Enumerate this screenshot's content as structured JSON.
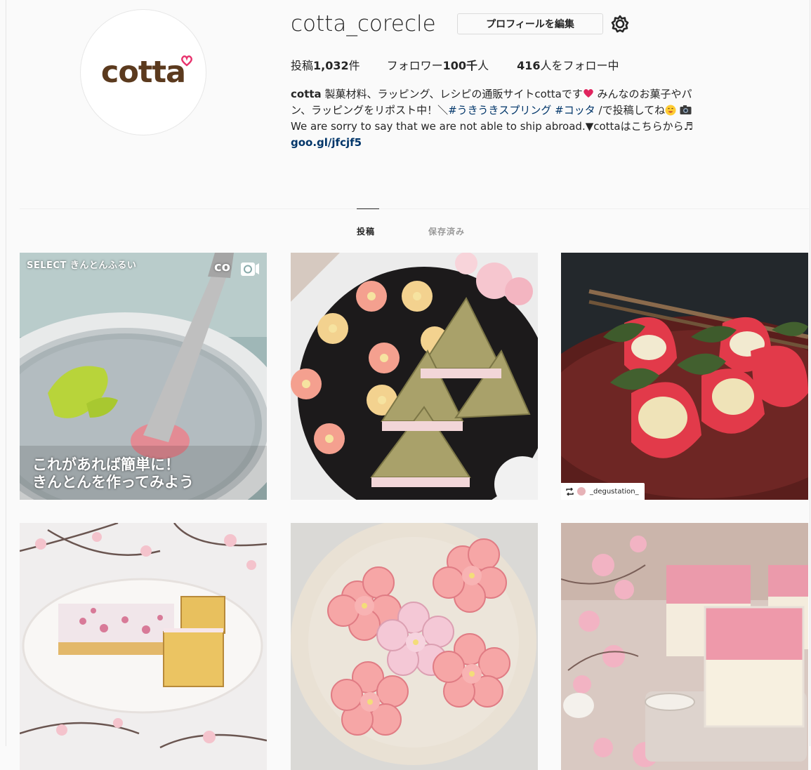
{
  "profile": {
    "avatar_logo_text": "cotta",
    "username": "cotta_corecle",
    "edit_profile_label": "プロフィールを編集",
    "stats": {
      "posts_prefix": "投稿",
      "posts_value": "1,032",
      "posts_suffix": "件",
      "followers_prefix": "フォロワー",
      "followers_value": "100千",
      "followers_suffix": "人",
      "following_value": "416",
      "following_suffix": "人をフォロー中"
    },
    "bio": {
      "name": "cotta",
      "line1_text": " 製菓材料、ラッピング、レシピの通販サイトcottaです",
      "line1_after_heart": " みんなのお菓子やパ",
      "line2_text": "ン、ラッピングをリポスト中！＼",
      "hashtag1": "#うきうきスプリング",
      "hashtag2": "#コッタ",
      "line2_after": " /で投稿してね",
      "line3_text": "We are sorry to say that we are not able to ship abroad.▼cottaはこちらから♬",
      "link": "goo.gl/jfcjf5"
    }
  },
  "tabs": {
    "posts_label": "投稿",
    "saved_label": "保存済み"
  },
  "grid": {
    "post1": {
      "overlay_title": "SELECT きんとんふるい",
      "brand": "co",
      "caption_line1": "これがあれば簡単に！",
      "caption_line2": "きんとんを作ってみよう"
    },
    "post3": {
      "repost_user": "_degustation_"
    }
  },
  "colors": {
    "background": "#fafafa",
    "link": "#003569",
    "text": "#262626",
    "muted": "#999999",
    "brand_brown": "#5b3a1e",
    "brand_pink": "#e8336d"
  }
}
